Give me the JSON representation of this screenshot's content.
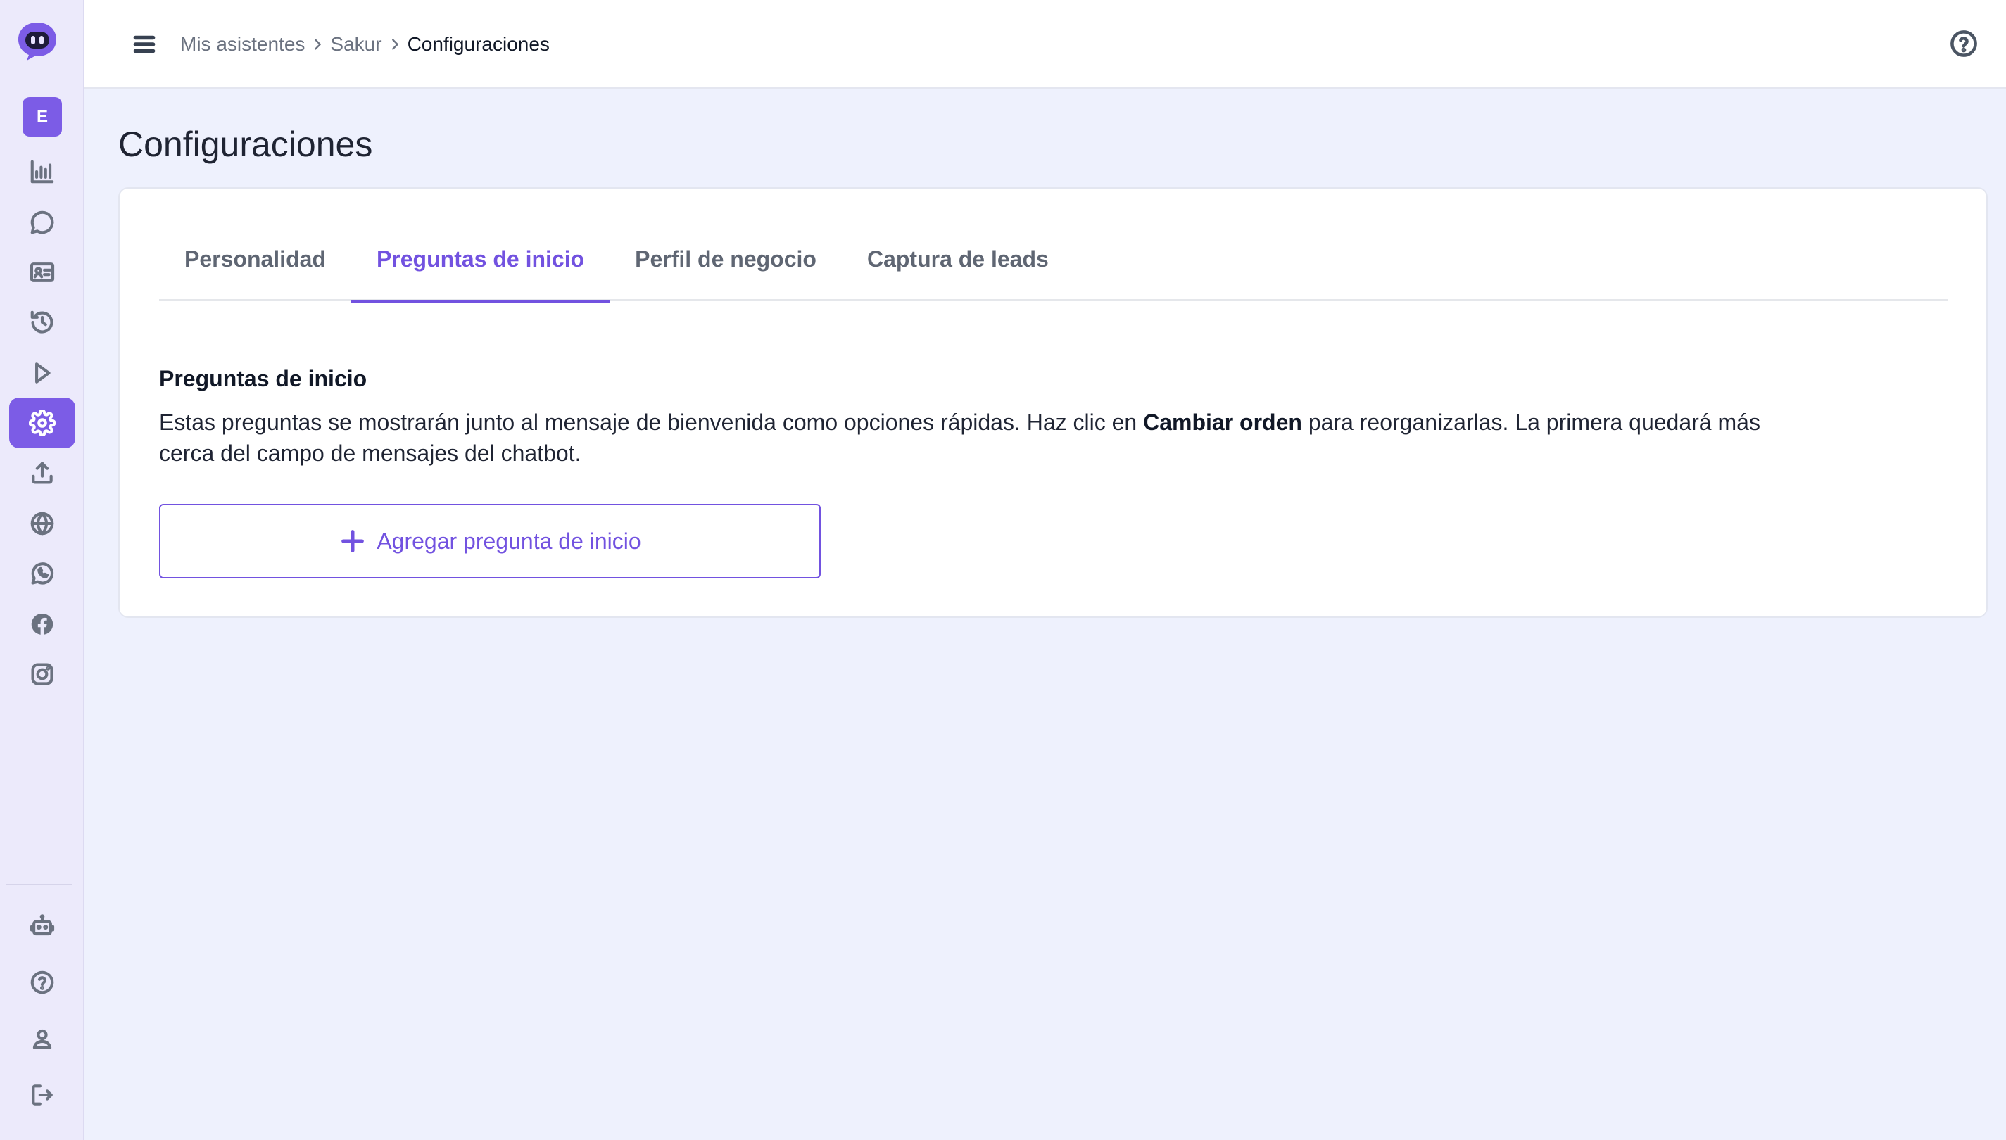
{
  "sidebar": {
    "workspace_initial": "E",
    "nav_icons": [
      "analytics-icon",
      "chat-icon",
      "contacts-icon",
      "history-icon",
      "play-icon",
      "settings-icon",
      "upload-icon",
      "globe-icon",
      "whatsapp-icon",
      "facebook-icon",
      "instagram-icon"
    ],
    "bottom_icons": [
      "bot-icon",
      "help-icon",
      "user-icon",
      "logout-icon"
    ],
    "active_item": "settings-icon",
    "accent_color": "#7c5ce6"
  },
  "header": {
    "breadcrumb": [
      "Mis asistentes",
      "Sakur",
      "Configuraciones"
    ]
  },
  "main": {
    "page_title": "Configuraciones",
    "tabs": [
      {
        "label": "Personalidad",
        "active": false
      },
      {
        "label": "Preguntas de inicio",
        "active": true
      },
      {
        "label": "Perfil de negocio",
        "active": false
      },
      {
        "label": "Captura de leads",
        "active": false
      }
    ],
    "section": {
      "title": "Preguntas de inicio",
      "desc_part1": "Estas preguntas se mostrarán junto al mensaje de bienvenida como opciones rápidas. Haz clic en ",
      "desc_bold": "Cambiar orden",
      "desc_part2": " para reorganizarlas. La primera quedará más cerca del campo de mensajes del chatbot.",
      "add_button": "Agregar pregunta de inicio"
    }
  }
}
